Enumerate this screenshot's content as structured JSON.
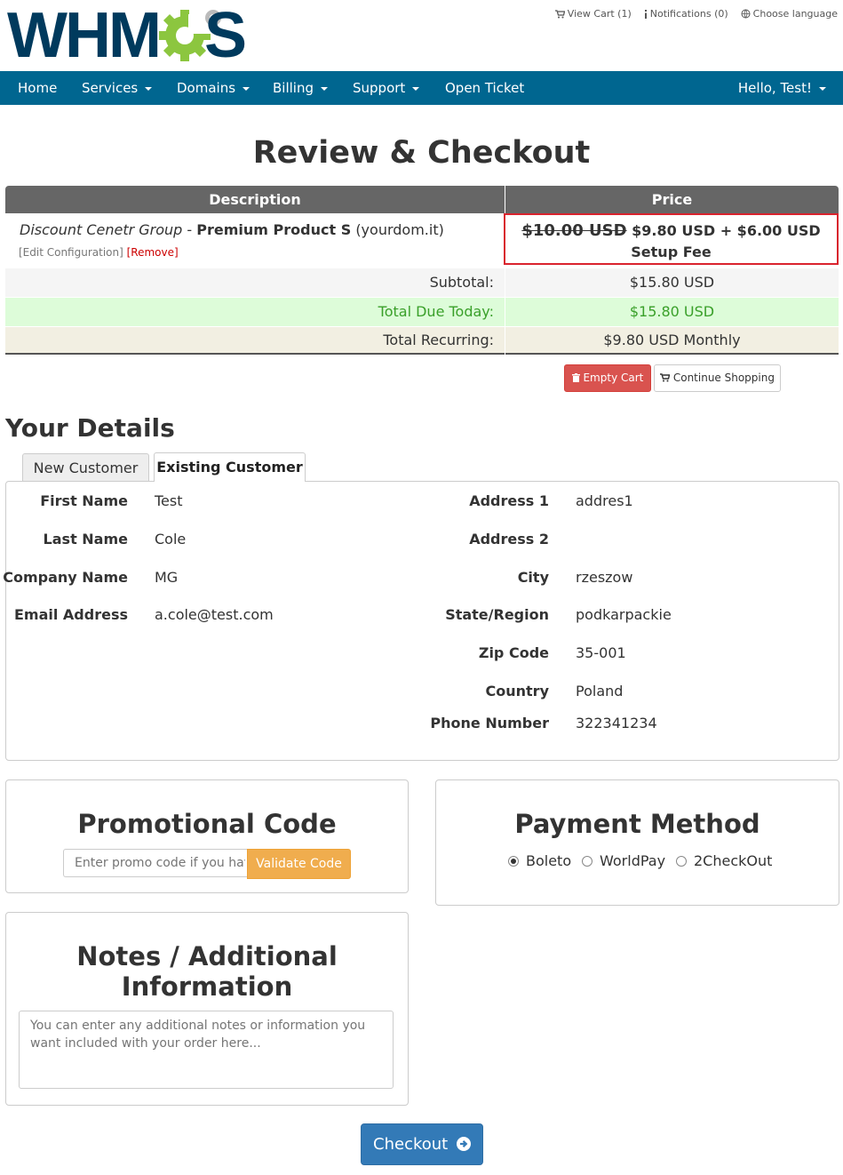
{
  "brand": {
    "logo_text": "WHMCS"
  },
  "top_links": {
    "view_cart": "View Cart (1)",
    "notifications": "Notifications (0)",
    "language": "Choose language"
  },
  "nav": {
    "items": [
      "Home",
      "Services",
      "Domains",
      "Billing",
      "Support",
      "Open Ticket"
    ],
    "user": "Hello, Test!"
  },
  "page_title": "Review & Checkout",
  "cart": {
    "headers": {
      "description": "Description",
      "price": "Price"
    },
    "item": {
      "group": "Discount Cenetr Group",
      "separator": " - ",
      "product": "Premium Product S",
      "domain": "(yourdom.it)",
      "edit": "[Edit Configuration]",
      "remove": "[Remove]",
      "old_price": "$10.00 USD",
      "new_price": "$9.80 USD + $6.00 USD Setup Fee"
    },
    "subtotal_label": "Subtotal:",
    "subtotal_value": "$15.80 USD",
    "due_label": "Total Due Today:",
    "due_value": "$15.80 USD",
    "recurring_label": "Total Recurring:",
    "recurring_value": "$9.80 USD Monthly",
    "empty_cart": "Empty Cart",
    "continue_shopping": "Continue Shopping"
  },
  "details": {
    "title": "Your Details",
    "tabs": [
      "New Customer",
      "Existing Customer"
    ],
    "left": [
      {
        "label": "First Name",
        "value": "Test"
      },
      {
        "label": "Last Name",
        "value": "Cole"
      },
      {
        "label": "Company Name",
        "value": "MG"
      },
      {
        "label": "Email Address",
        "value": "a.cole@test.com"
      }
    ],
    "right": [
      {
        "label": "Address 1",
        "value": "addres1"
      },
      {
        "label": "Address 2",
        "value": ""
      },
      {
        "label": "City",
        "value": "rzeszow"
      },
      {
        "label": "State/Region",
        "value": "podkarpackie"
      },
      {
        "label": "Zip Code",
        "value": "35-001"
      },
      {
        "label": "Country",
        "value": "Poland"
      },
      {
        "label": "Phone Number",
        "value": "322341234"
      }
    ]
  },
  "promo": {
    "title": "Promotional Code",
    "placeholder": "Enter promo code if you hav",
    "button": "Validate Code"
  },
  "payment": {
    "title": "Payment Method",
    "options": [
      "Boleto",
      "WorldPay",
      "2CheckOut"
    ],
    "selected": "Boleto"
  },
  "notes": {
    "title_line1": "Notes / Additional",
    "title_line2": "Information",
    "placeholder": "You can enter any additional notes or information you want included with your order here..."
  },
  "checkout_button": "Checkout",
  "colors": {
    "navbar": "#006690",
    "logo_blue": "#003a5d",
    "logo_green": "#8cc63f",
    "table_header": "#666666",
    "highlight_border": "#d9232d",
    "due_green": "#3aa02a",
    "danger": "#d9534f",
    "warning": "#f0ad4e",
    "primary": "#337ab7"
  },
  "icons": {
    "cart": "cart-icon",
    "info": "info-icon",
    "globe": "globe-icon",
    "trash": "trash-icon",
    "arrow": "arrow-circle-right-icon"
  }
}
